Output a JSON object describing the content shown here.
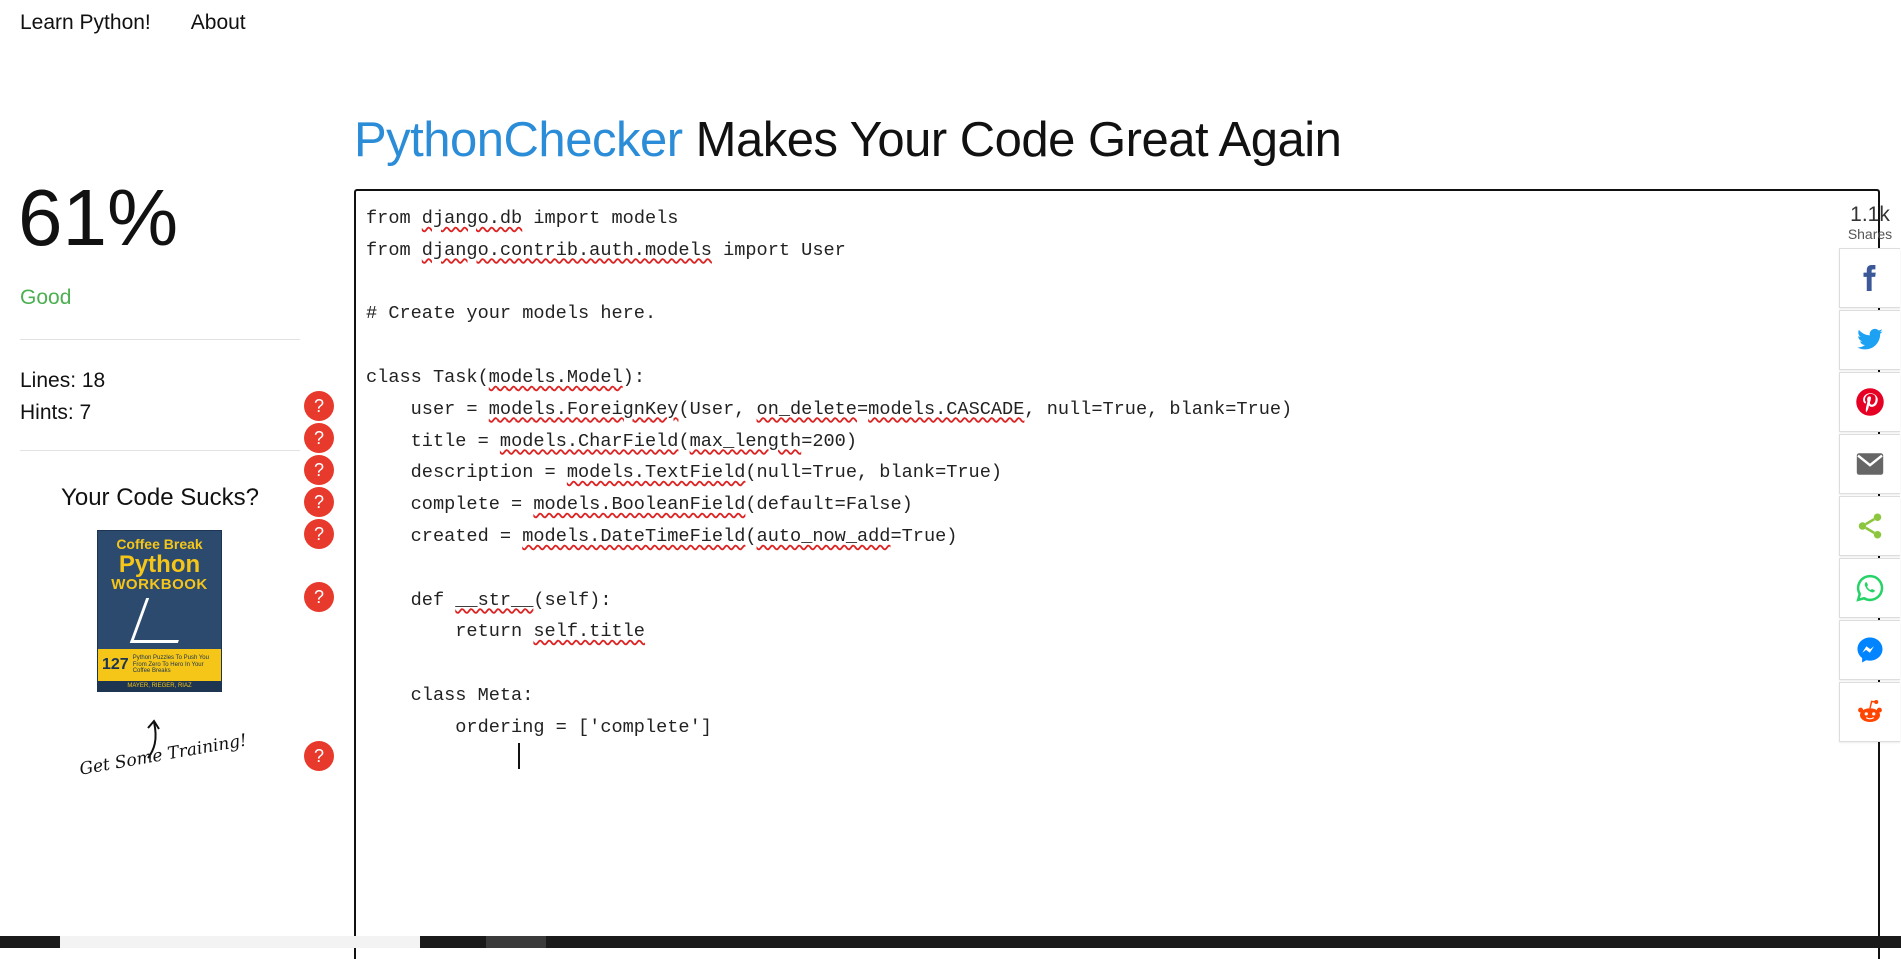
{
  "nav": {
    "home": "Learn Python!",
    "about": "About"
  },
  "heading": {
    "brand": "PythonChecker",
    "rest": " Makes Your Code Great Again"
  },
  "stats": {
    "score": "61%",
    "rating": "Good",
    "lines": "Lines: 18",
    "hints": "Hints: 7"
  },
  "promo": {
    "title": "Your Code Sucks?",
    "book": {
      "line1": "Coffee Break",
      "line2": "Python",
      "line3": "WORKBOOK",
      "number": "127",
      "tagline": "Python Puzzles To Push You From Zero To Hero In Your Coffee Breaks",
      "authors": "MAYER, RIEGER, RIAZ"
    },
    "cta": "Get Some Training!"
  },
  "hint_symbol": "?",
  "code_lines": [
    "from django.db import models",
    "from django.contrib.auth.models import User",
    "",
    "# Create your models here.",
    "",
    "class Task(models.Model):",
    "    user = models.ForeignKey(User, on_delete=models.CASCADE, null=True, blank=True)",
    "    title = models.CharField(max_length=200)",
    "    description = models.TextField(null=True, blank=True)",
    "    complete = models.BooleanField(default=False)",
    "    created = models.DateTimeField(auto_now_add=True)",
    "",
    "    def __str__(self):",
    "        return self.title",
    "",
    "    class Meta:",
    "        ordering = ['complete']",
    ""
  ],
  "share": {
    "count": "1.1k",
    "label": "Shares",
    "buttons": [
      {
        "name": "facebook",
        "color": "#3b5998"
      },
      {
        "name": "twitter",
        "color": "#1da1f2"
      },
      {
        "name": "pinterest",
        "color": "#e60023"
      },
      {
        "name": "email",
        "color": "#666666"
      },
      {
        "name": "share",
        "color": "#8cc63f"
      },
      {
        "name": "whatsapp",
        "color": "#25d366"
      },
      {
        "name": "messenger",
        "color": "#0084ff"
      },
      {
        "name": "reddit",
        "color": "#ff4500"
      }
    ]
  },
  "colors": {
    "brand": "#2b8cd8",
    "good": "#4caf50",
    "hint": "#e83a2c"
  }
}
